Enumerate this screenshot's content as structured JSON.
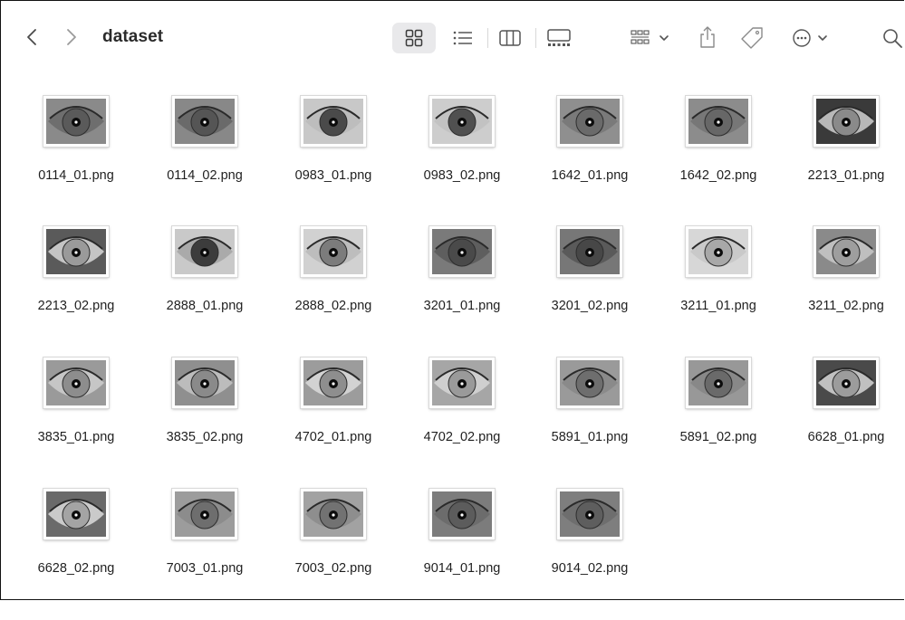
{
  "window": {
    "title": "dataset"
  },
  "toolbar": {
    "back_icon": "chevron-left-icon",
    "forward_icon": "chevron-right-icon",
    "view_icons": [
      "icon-view-icon",
      "list-view-icon",
      "column-view-icon",
      "gallery-view-icon"
    ],
    "active_view": "icon-view",
    "group_icon": "group-by-icon",
    "share_icon": "share-icon",
    "tag_icon": "tag-icon",
    "more_icon": "more-actions-icon",
    "search_icon": "search-icon"
  },
  "files": [
    {
      "name": "0114_01.png",
      "tone": "#6e6e6e",
      "iris": "#5a5a5a",
      "bg": "#8a8a8a"
    },
    {
      "name": "0114_02.png",
      "tone": "#6a6a6a",
      "iris": "#555555",
      "bg": "#888888"
    },
    {
      "name": "0983_01.png",
      "tone": "#bdbdbd",
      "iris": "#4a4a4a",
      "bg": "#c8c8c8"
    },
    {
      "name": "0983_02.png",
      "tone": "#c2c2c2",
      "iris": "#505050",
      "bg": "#cdcdcd"
    },
    {
      "name": "1642_01.png",
      "tone": "#7a7a7a",
      "iris": "#6a6a6a",
      "bg": "#8f8f8f"
    },
    {
      "name": "1642_02.png",
      "tone": "#777777",
      "iris": "#676767",
      "bg": "#8c8c8c"
    },
    {
      "name": "2213_01.png",
      "tone": "#b8b8b8",
      "iris": "#8a8a8a",
      "bg": "#3a3a3a"
    },
    {
      "name": "2213_02.png",
      "tone": "#c4c4c4",
      "iris": "#9a9a9a",
      "bg": "#5a5a5a"
    },
    {
      "name": "2888_01.png",
      "tone": "#aaaaaa",
      "iris": "#3c3c3c",
      "bg": "#c9c9c9"
    },
    {
      "name": "2888_02.png",
      "tone": "#bdbdbd",
      "iris": "#7c7c7c",
      "bg": "#d1d1d1"
    },
    {
      "name": "3201_01.png",
      "tone": "#5e5e5e",
      "iris": "#4a4a4a",
      "bg": "#7a7a7a"
    },
    {
      "name": "3201_02.png",
      "tone": "#5a5a5a",
      "iris": "#474747",
      "bg": "#777777"
    },
    {
      "name": "3211_01.png",
      "tone": "#c9c9c9",
      "iris": "#a8a8a8",
      "bg": "#d7d7d7"
    },
    {
      "name": "3211_02.png",
      "tone": "#bfbfbf",
      "iris": "#9e9e9e",
      "bg": "#8a8a8a"
    },
    {
      "name": "3835_01.png",
      "tone": "#c6c6c6",
      "iris": "#8d8d8d",
      "bg": "#9a9a9a"
    },
    {
      "name": "3835_02.png",
      "tone": "#bcbcbc",
      "iris": "#8a8a8a",
      "bg": "#8f8f8f"
    },
    {
      "name": "4702_01.png",
      "tone": "#d2d2d2",
      "iris": "#8e8e8e",
      "bg": "#9c9c9c"
    },
    {
      "name": "4702_02.png",
      "tone": "#cfcfcf",
      "iris": "#9a9a9a",
      "bg": "#a6a6a6"
    },
    {
      "name": "5891_01.png",
      "tone": "#8a8a8a",
      "iris": "#6e6e6e",
      "bg": "#9a9a9a"
    },
    {
      "name": "5891_02.png",
      "tone": "#888888",
      "iris": "#6a6a6a",
      "bg": "#989898"
    },
    {
      "name": "6628_01.png",
      "tone": "#c0c0c0",
      "iris": "#9c9c9c",
      "bg": "#4a4a4a"
    },
    {
      "name": "6628_02.png",
      "tone": "#cacaca",
      "iris": "#a4a4a4",
      "bg": "#6a6a6a"
    },
    {
      "name": "7003_01.png",
      "tone": "#8c8c8c",
      "iris": "#6e6e6e",
      "bg": "#9c9c9c"
    },
    {
      "name": "7003_02.png",
      "tone": "#8e8e8e",
      "iris": "#727272",
      "bg": "#a2a2a2"
    },
    {
      "name": "9014_01.png",
      "tone": "#6c6c6c",
      "iris": "#5c5c5c",
      "bg": "#7c7c7c"
    },
    {
      "name": "9014_02.png",
      "tone": "#6e6e6e",
      "iris": "#5e5e5e",
      "bg": "#7e7e7e"
    }
  ]
}
